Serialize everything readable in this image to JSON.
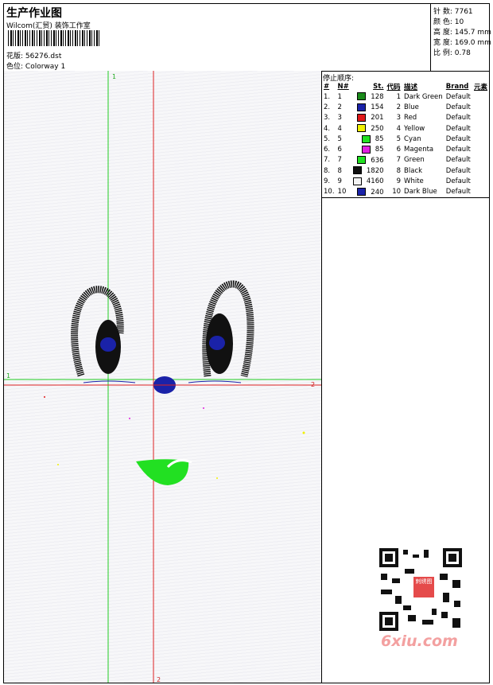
{
  "header": {
    "title": "生产作业图",
    "company": "Wilcom(汇贸) 装饰工作室",
    "design_label": "花版:",
    "design_value": "56276.dst",
    "colorway_label": "色位:",
    "colorway_value": "Colorway 1"
  },
  "stats": {
    "stitches": "针 数: 7761",
    "colors": "颜 色: 10",
    "height": "高 度: 145.7 mm",
    "width": "宽 度: 169.0 mm",
    "ratio": "比 例: 0.78"
  },
  "canvas": {
    "v1_label": "1",
    "h1_label": "1",
    "h2_label": "2",
    "v2_label": "2",
    "colors": {
      "green_line": "#22cc22",
      "red_line": "#dd2222",
      "blue": "#1a22a8",
      "black": "#111111",
      "bright_green": "#22e022"
    }
  },
  "legend": {
    "title": "停止顺序:",
    "headers": [
      "#",
      "N#",
      "St.",
      "代码",
      "描述",
      "Brand",
      "元素"
    ],
    "rows": [
      {
        "idx": "1.",
        "n": "1",
        "color": "#1a8a1a",
        "st": "128",
        "code": "1",
        "desc": "Dark Green",
        "brand": "Default"
      },
      {
        "idx": "2.",
        "n": "2",
        "color": "#1a22a8",
        "st": "154",
        "code": "2",
        "desc": "Blue",
        "brand": "Default"
      },
      {
        "idx": "3.",
        "n": "3",
        "color": "#e01818",
        "st": "201",
        "code": "3",
        "desc": "Red",
        "brand": "Default"
      },
      {
        "idx": "4.",
        "n": "4",
        "color": "#f0f000",
        "st": "250",
        "code": "4",
        "desc": "Yellow",
        "brand": "Default"
      },
      {
        "idx": "5.",
        "n": "5",
        "color": "#22e022",
        "st": "85",
        "code": "5",
        "desc": "Cyan",
        "brand": "Default"
      },
      {
        "idx": "6.",
        "n": "6",
        "color": "#e020e0",
        "st": "85",
        "code": "6",
        "desc": "Magenta",
        "brand": "Default"
      },
      {
        "idx": "7.",
        "n": "7",
        "color": "#22e022",
        "st": "636",
        "code": "7",
        "desc": "Green",
        "brand": "Default"
      },
      {
        "idx": "8.",
        "n": "8",
        "color": "#111111",
        "st": "1820",
        "code": "8",
        "desc": "Black",
        "brand": "Default"
      },
      {
        "idx": "9.",
        "n": "9",
        "color": "#f4f4f4",
        "st": "4160",
        "code": "9",
        "desc": "White",
        "brand": "Default"
      },
      {
        "idx": "10.",
        "n": "10",
        "color": "#1a22a8",
        "st": "240",
        "code": "10",
        "desc": "Dark Blue",
        "brand": "Default"
      }
    ]
  },
  "watermark": {
    "text": "6xiu.com",
    "logo_text": "刺绣图"
  }
}
